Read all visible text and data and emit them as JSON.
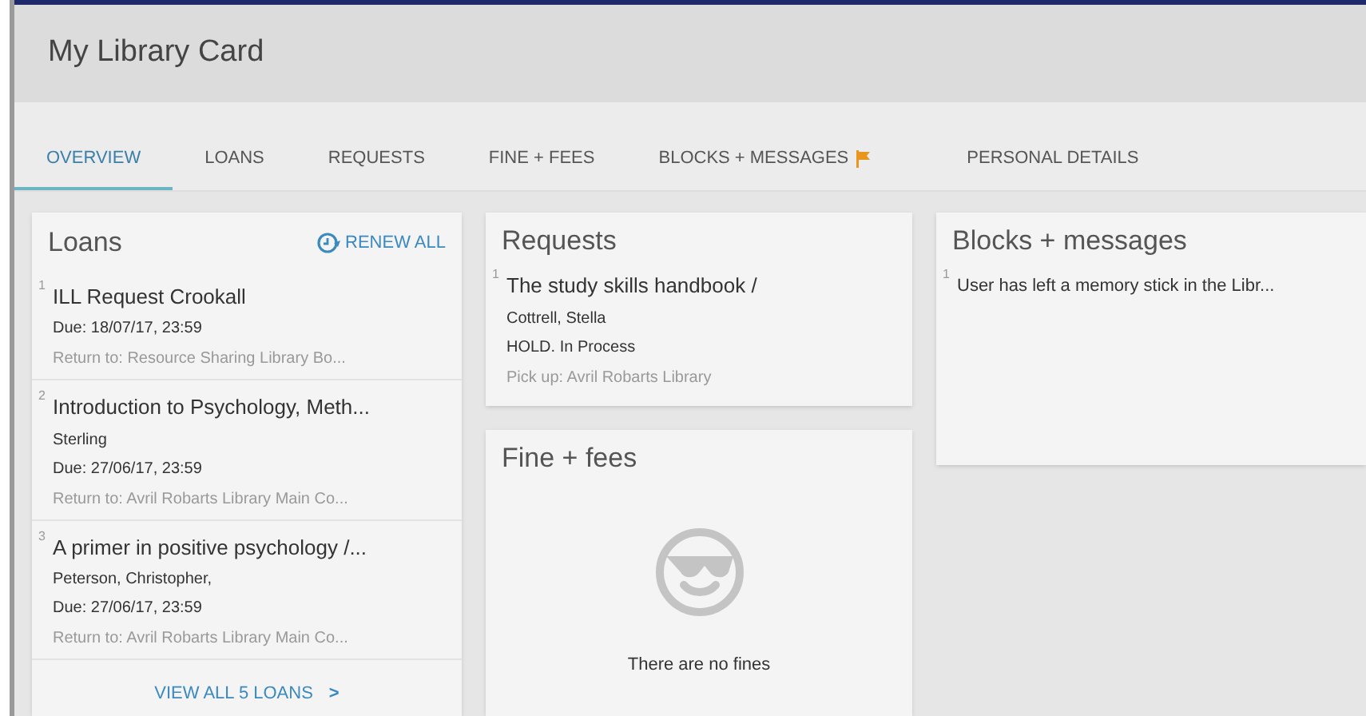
{
  "header": {
    "title": "My Library Card"
  },
  "tabs": [
    {
      "label": "OVERVIEW",
      "selected": true,
      "flagged": false
    },
    {
      "label": "LOANS",
      "selected": false,
      "flagged": false
    },
    {
      "label": "REQUESTS",
      "selected": false,
      "flagged": false
    },
    {
      "label": "FINE + FEES",
      "selected": false,
      "flagged": false
    },
    {
      "label": "BLOCKS + MESSAGES",
      "selected": false,
      "flagged": true
    },
    {
      "label": "PERSONAL DETAILS",
      "selected": false,
      "flagged": false
    }
  ],
  "loans": {
    "title": "Loans",
    "action": "RENEW ALL",
    "items": [
      {
        "number": "1",
        "title": "ILL Request Crookall",
        "due": "Due: 18/07/17, 23:59",
        "return_to": "Return to: Resource Sharing Library Bo..."
      },
      {
        "number": "2",
        "title": "Introduction to Psychology, Meth...",
        "author": "Sterling",
        "due": "Due: 27/06/17, 23:59",
        "return_to": "Return to: Avril Robarts Library Main Co..."
      },
      {
        "number": "3",
        "title": "A primer in positive psychology /...",
        "author": "Peterson, Christopher,",
        "due": "Due: 27/06/17, 23:59",
        "return_to": "Return to: Avril Robarts Library Main Co..."
      }
    ],
    "view_all": "VIEW ALL 5 LOANS",
    "view_all_arrow": ">"
  },
  "requests": {
    "title": "Requests",
    "items": [
      {
        "number": "1",
        "title": "The study skills handbook /",
        "author": "Cottrell, Stella",
        "status": "HOLD. In Process",
        "pickup": "Pick up: Avril Robarts Library"
      }
    ]
  },
  "fines": {
    "title": "Fine + fees",
    "empty_message": "There are no fines"
  },
  "blocks": {
    "title": "Blocks + messages",
    "items": [
      {
        "number": "1",
        "message": "User has left a memory stick in the Libr..."
      }
    ]
  }
}
